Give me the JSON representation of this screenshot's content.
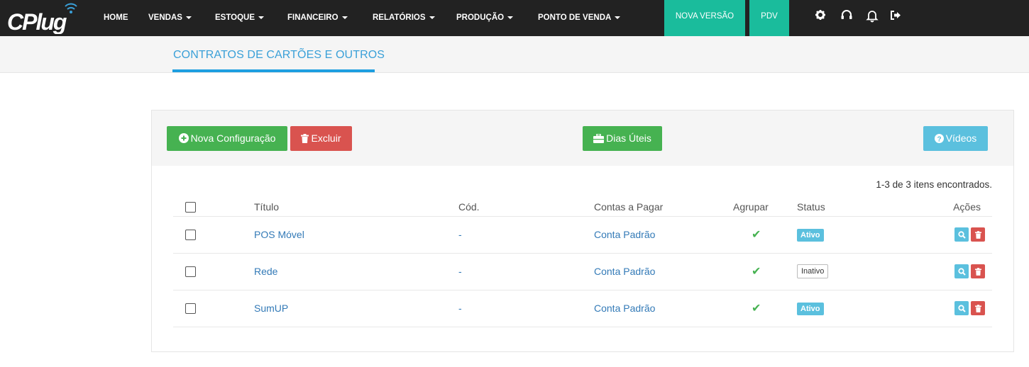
{
  "brand": {
    "logo_text": "CPlug"
  },
  "nav": {
    "items": [
      {
        "label": "HOME",
        "dropdown": false
      },
      {
        "label": "VENDAS",
        "dropdown": true
      },
      {
        "label": "ESTOQUE",
        "dropdown": true
      },
      {
        "label": "FINANCEIRO",
        "dropdown": true
      },
      {
        "label": "RELATÓRIOS",
        "dropdown": true
      },
      {
        "label": "PRODUÇÃO",
        "dropdown": true
      },
      {
        "label": "PONTO DE VENDA",
        "dropdown": true
      }
    ],
    "nova_versao": "NOVA VERSÃO",
    "pdv": "PDV",
    "icons": [
      "gear-icon",
      "headset-icon",
      "bell-icon",
      "logout-icon"
    ]
  },
  "subheader": {
    "tab_title": "CONTRATOS DE CARTÕES E OUTROS"
  },
  "toolbar": {
    "nova_configuracao": "Nova Configuração",
    "excluir": "Excluir",
    "dias_uteis": "Dias Úteis",
    "videos": "Vídeos"
  },
  "table": {
    "count_text": "1-3 de 3 itens encontrados.",
    "headers": {
      "titulo": "Título",
      "cod": "Cód.",
      "contas_a_pagar": "Contas a Pagar",
      "agrupar": "Agrupar",
      "status": "Status",
      "acoes": "Ações"
    },
    "rows": [
      {
        "titulo": "POS Móvel",
        "cod": "-",
        "contas": "Conta Padrão",
        "agrupar": "✔",
        "status": "Ativo"
      },
      {
        "titulo": "Rede",
        "cod": "-",
        "contas": "Conta Padrão",
        "agrupar": "✔",
        "status": "Inativo"
      },
      {
        "titulo": "SumUP",
        "cod": "-",
        "contas": "Conta Padrão",
        "agrupar": "✔",
        "status": "Ativo"
      }
    ]
  },
  "colors": {
    "navbar": "#222222",
    "teal": "#1abc9c",
    "green": "#46b251",
    "red": "#d9534f",
    "info": "#5bc0de",
    "link": "#337ab7",
    "tab_accent": "#1e9ee0"
  }
}
